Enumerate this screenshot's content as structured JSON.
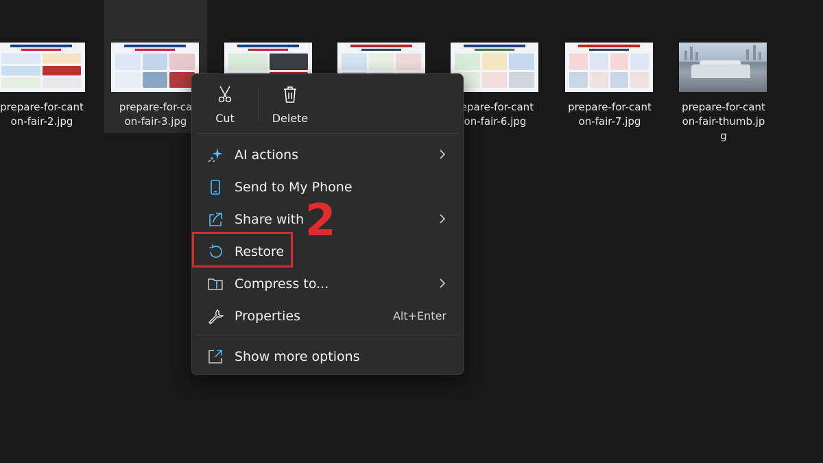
{
  "files": [
    {
      "name": "prepare-for-canton-fair-2.jpg",
      "thumb": "infographic-register"
    },
    {
      "name": "prepare-for-canton-fair-3.jpg",
      "thumb": "infographic-things-to-prepare",
      "selected": true
    },
    {
      "name": "",
      "thumb": "infographic-packing-list"
    },
    {
      "name": "",
      "thumb": "infographic-canton-fair"
    },
    {
      "name": "prepare-for-canton-fair-6.jpg",
      "thumb": "infographic-what-to-do-next"
    },
    {
      "name": "prepare-for-canton-fair-7.jpg",
      "thumb": "infographic-common-mistakes"
    },
    {
      "name": "prepare-for-canton-fair-thumb.jpg",
      "thumb": "photo-exhibition-center"
    }
  ],
  "labels": {
    "f0a": "prepare-for-cant",
    "f0b": "on-fair-2.jpg",
    "f1a": "prepare-for-ca",
    "f1b": "on-fair-3.jpg",
    "f4a": "repare-for-cant",
    "f4b": "on-fair-6.jpg",
    "f5a": "prepare-for-cant",
    "f5b": "on-fair-7.jpg",
    "f6a": "prepare-for-cant",
    "f6b": "on-fair-thumb.jp",
    "f6c": "g"
  },
  "context_menu": {
    "top_actions": [
      {
        "label": "Cut",
        "icon": "scissors-icon"
      },
      {
        "label": "Delete",
        "icon": "trash-icon"
      }
    ],
    "items": [
      {
        "label": "AI actions",
        "icon": "sparkle-icon",
        "submenu": true
      },
      {
        "label": "Send to My Phone",
        "icon": "phone-icon"
      },
      {
        "label": "Share with",
        "icon": "share-icon",
        "submenu": true
      },
      {
        "label": "Restore",
        "icon": "restore-icon"
      },
      {
        "label": "Compress to...",
        "icon": "zip-folder-icon",
        "submenu": true
      },
      {
        "label": "Properties",
        "icon": "wrench-icon",
        "shortcut": "Alt+Enter"
      },
      {
        "label": "Show more options",
        "icon": "expand-icon"
      }
    ]
  },
  "annotation": {
    "step": "2",
    "color": "#e0262c"
  },
  "colors": {
    "accent": "#4cc2ff",
    "background": "#191919",
    "menu": "#2c2c2c"
  }
}
